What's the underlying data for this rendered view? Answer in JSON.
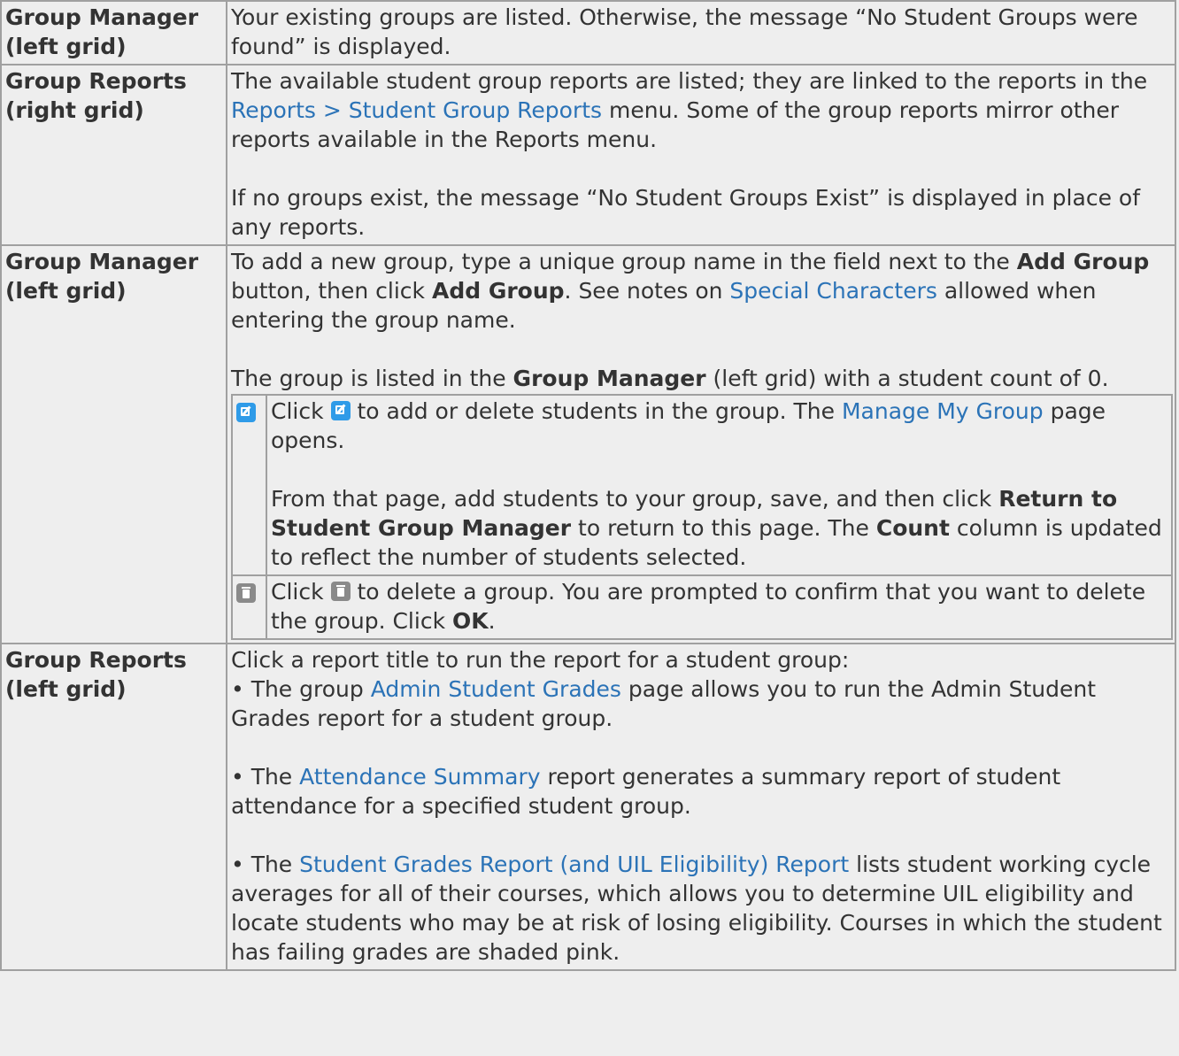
{
  "rows": [
    {
      "label": "Group Manager (left grid)",
      "text_before": "Your existing groups are listed. Otherwise, the message “No Student Groups were found” is displayed."
    },
    {
      "label": "Group Reports (right grid)",
      "p1_before": "The available student group reports are listed; they are linked to the reports in the ",
      "p1_link": "Reports > Student Group Reports",
      "p1_after": " menu. Some of the group reports mirror other reports available in the Reports menu.",
      "p2": "If no groups exist, the message “No Student Groups Exist” is displayed in place of any reports."
    },
    {
      "label": "Group Manager (left grid)",
      "p1_a": "To add a new group, type a unique group name in the field next to the ",
      "p1_b1": "Add Group",
      "p1_c": " button, then click ",
      "p1_b2": "Add Group",
      "p1_d": ". See notes on ",
      "p1_link": "Special Characters",
      "p1_e": " allowed when entering the group name.",
      "p2_a": "The group is listed in the ",
      "p2_b": "Group Manager",
      "p2_c": " (left grid) with a student count of 0.",
      "edit": {
        "click": "Click ",
        "a": " to add or delete students in the group. The ",
        "link": "Manage My Group",
        "b": " page opens.",
        "p2_a": "From that page, add students to your group, save, and then click ",
        "p2_b": "Return to Student Group Manager",
        "p2_c": " to return to this page. The ",
        "p2_d": "Count",
        "p2_e": " column is updated to reflect the number of students selected."
      },
      "delete": {
        "click": "Click ",
        "a": " to delete a group. You are prompted to confirm that you want to delete the group. Click ",
        "b": "OK",
        "c": "."
      }
    },
    {
      "label": "Group Reports (left grid)",
      "intro": "Click a report title to run the report for a student group:",
      "i1_a": "• The group ",
      "i1_link": "Admin Student Grades",
      "i1_b": " page allows you to run the Admin Student Grades report for a student group.",
      "i2_a": "• The ",
      "i2_link": "Attendance Summary",
      "i2_b": " report generates a summary report of student attendance for a specified student group.",
      "i3_a": "• The ",
      "i3_link": "Student Grades Report (and UIL Eligibility) Report",
      "i3_b": " lists student working cycle averages for all of their courses, which allows you to determine UIL eligibility and locate students who may be at risk of losing eligibility. Courses in which the student has failing grades are shaded pink."
    }
  ],
  "icons": {
    "edit": "edit-icon",
    "delete": "trash-icon"
  },
  "colors": {
    "link": "#2b73b7",
    "border": "#a0a0a0",
    "background": "#eeeeee",
    "edit_icon": "#2f9be8",
    "delete_icon": "#8a8a8a"
  }
}
